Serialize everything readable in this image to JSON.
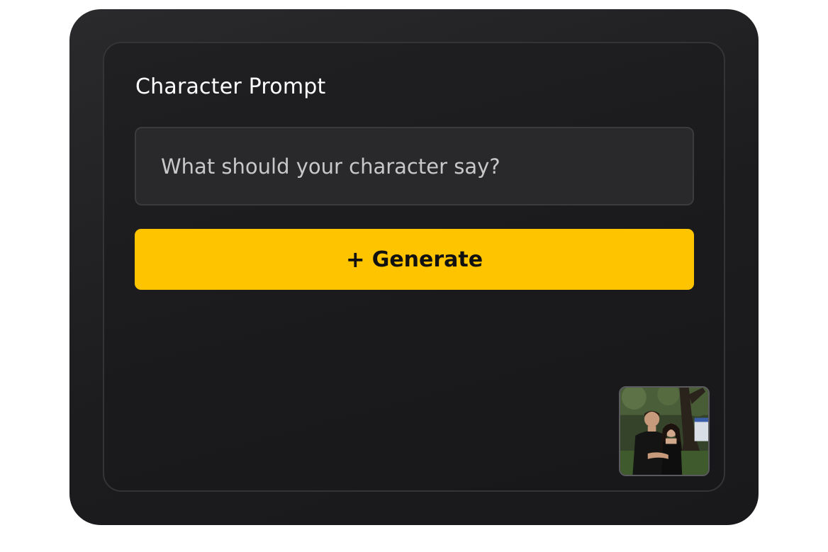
{
  "panel": {
    "title": "Character Prompt"
  },
  "prompt": {
    "placeholder": "What should your character say?",
    "value": ""
  },
  "generate": {
    "icon": "plus-icon",
    "icon_glyph": "+",
    "label": "Generate",
    "color": "#fec400"
  },
  "thumbnail": {
    "description_icon": "character-photo-thumbnail"
  },
  "colors": {
    "card_background": "#1c1c1e",
    "panel_border": "#343437",
    "input_background": "#29292b",
    "accent": "#fec400"
  }
}
